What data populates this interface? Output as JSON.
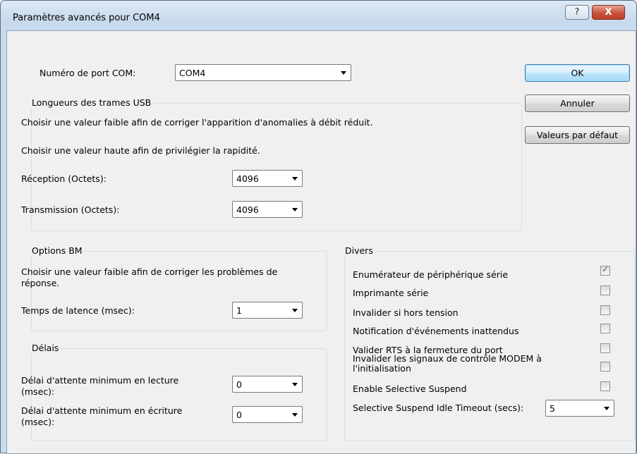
{
  "window": {
    "title": "Paramètres avancés pour COM4",
    "help_glyph": "?",
    "close_glyph": "X"
  },
  "port": {
    "label": "Numéro de port COM:",
    "value": "COM4"
  },
  "buttons": {
    "ok": "OK",
    "cancel": "Annuler",
    "defaults": "Valeurs par défaut"
  },
  "usb": {
    "legend": "Longueurs des trames USB",
    "note_low": "Choisir une valeur faible afin de corriger  l'apparition d'anomalies à débit réduit.",
    "note_high": "Choisir une valeur haute afin de privilégier la rapidité.",
    "rx_label": "Réception (Octets):",
    "rx_value": "4096",
    "tx_label": "Transmission (Octets):",
    "tx_value": "4096"
  },
  "bm": {
    "legend": "Options BM",
    "note_line1": "Choisir une valeur faible afin de corriger les problèmes de",
    "note_line2": "réponse.",
    "latency_label": "Temps de latence (msec):",
    "latency_value": "1"
  },
  "timeouts": {
    "legend": "Délais",
    "read_line1": "Délai d'attente minimum en lecture",
    "read_line2": "(msec):",
    "read_value": "0",
    "write_line1": "Délai d'attente minimum en écriture",
    "write_line2": "(msec):",
    "write_value": "0"
  },
  "misc": {
    "legend": "Divers",
    "items": [
      {
        "label": "Enumérateur de périphérique série",
        "checked": true
      },
      {
        "label": "Imprimante série",
        "checked": false
      },
      {
        "label": "Invalider si hors tension",
        "checked": false
      },
      {
        "label": "Notification d'événements inattendus",
        "checked": false
      },
      {
        "label": "Valider RTS à la fermeture du port",
        "checked": false
      },
      {
        "label": "Invalider les signaux de contrôle MODEM à",
        "label2": "l'initialisation",
        "checked": false
      },
      {
        "label": "Enable Selective Suspend",
        "checked": false
      }
    ],
    "idle_label": "Selective Suspend Idle Timeout (secs):",
    "idle_value": "5",
    "check_glyph": "✓"
  }
}
